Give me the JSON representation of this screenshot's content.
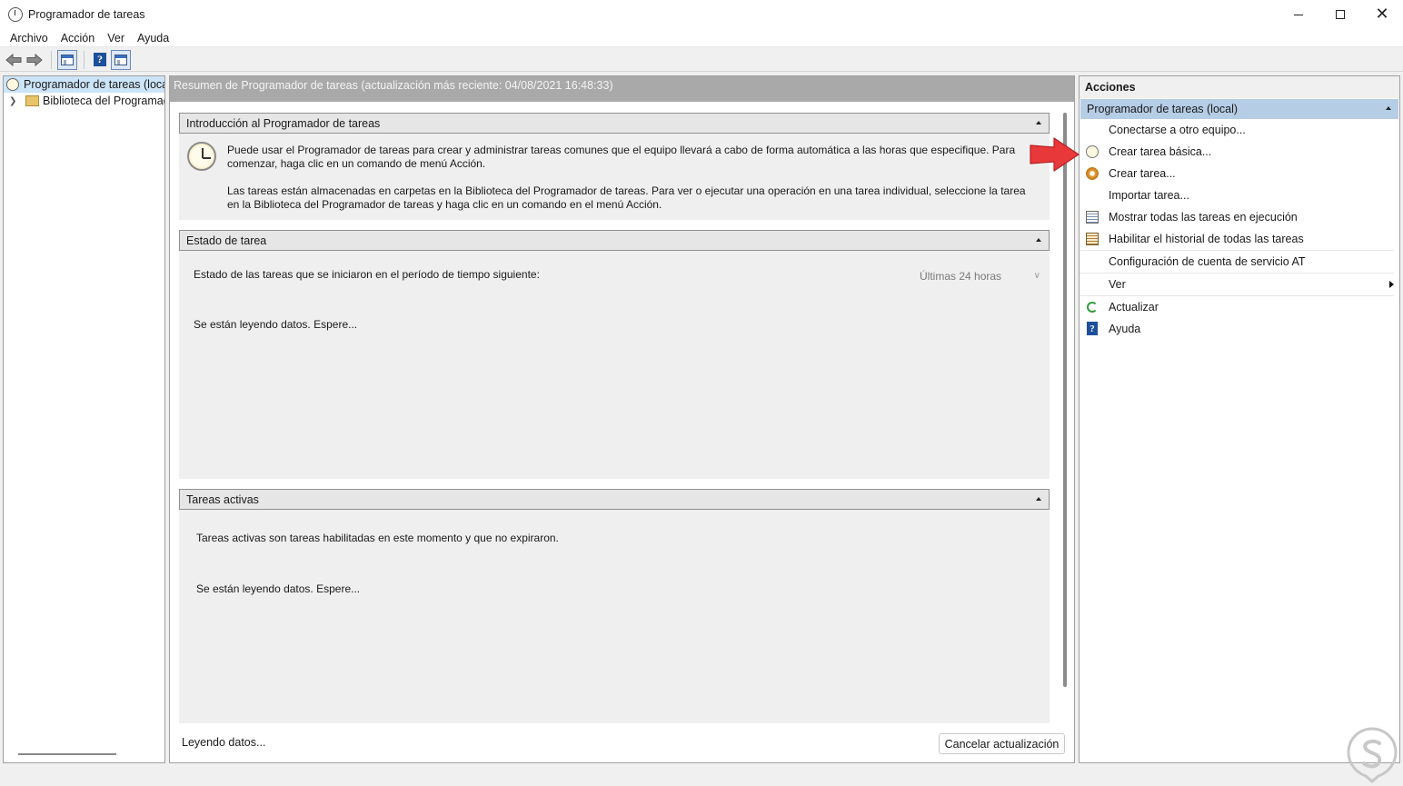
{
  "window": {
    "title": "Programador de tareas",
    "close_glyph": "✕"
  },
  "menubar": {
    "items": [
      "Archivo",
      "Acción",
      "Ver",
      "Ayuda"
    ]
  },
  "toolbar": {
    "help_glyph": "?",
    "back_icon": "arrow-left-icon",
    "forward_icon": "arrow-right-icon"
  },
  "tree": {
    "root_label": "Programador de tareas (local)",
    "child_label": "Biblioteca del Programador de tareas"
  },
  "center": {
    "header": "Resumen de Programador de tareas (actualización más reciente: 04/08/2021 16:48:33)",
    "intro": {
      "title": "Introducción al Programador de tareas",
      "paragraph1": "Puede usar el Programador de tareas para crear y administrar tareas comunes que el equipo llevará a cabo de forma automática a las horas que especifique. Para comenzar, haga clic en un comando de menú Acción.",
      "paragraph2": "Las tareas están almacenadas en carpetas en la Biblioteca del Programador de tareas. Para ver o ejecutar una operación en una tarea individual, seleccione la tarea en la Biblioteca del Programador de tareas y haga clic en un comando en el menú Acción."
    },
    "task_status": {
      "title": "Estado de tarea",
      "period_label": "Estado de las tareas que se iniciaron en el período de tiempo siguiente:",
      "period_value": "Últimas 24 horas",
      "loading": "Se están leyendo datos. Espere..."
    },
    "active_tasks": {
      "title": "Tareas activas",
      "description": "Tareas activas son tareas habilitadas en este momento y que no expiraron.",
      "loading": "Se están leyendo datos. Espere..."
    },
    "status_text": "Leyendo datos...",
    "cancel_button": "Cancelar actualización"
  },
  "actions": {
    "header": "Acciones",
    "group": "Programador de tareas (local)",
    "items": [
      {
        "label": "Conectarse a otro equipo...",
        "icon": ""
      },
      {
        "label": "Crear tarea básica...",
        "icon": "clock-icon"
      },
      {
        "label": "Crear tarea...",
        "icon": "gear-icon"
      },
      {
        "label": "Importar tarea...",
        "icon": ""
      },
      {
        "label": "Mostrar todas las tareas en ejecución",
        "icon": "task-list-icon"
      },
      {
        "label": "Habilitar el historial de todas las tareas",
        "icon": "history-icon"
      },
      {
        "label": "Configuración de cuenta de servicio AT",
        "icon": ""
      },
      {
        "label": "Ver",
        "icon": ""
      },
      {
        "label": "Actualizar",
        "icon": "refresh-icon"
      },
      {
        "label": "Ayuda",
        "icon": "help-icon"
      }
    ]
  },
  "colors": {
    "annotation_arrow": "#e8383a",
    "selection": "#cce4f7",
    "actions_group": "#b6cde6"
  }
}
